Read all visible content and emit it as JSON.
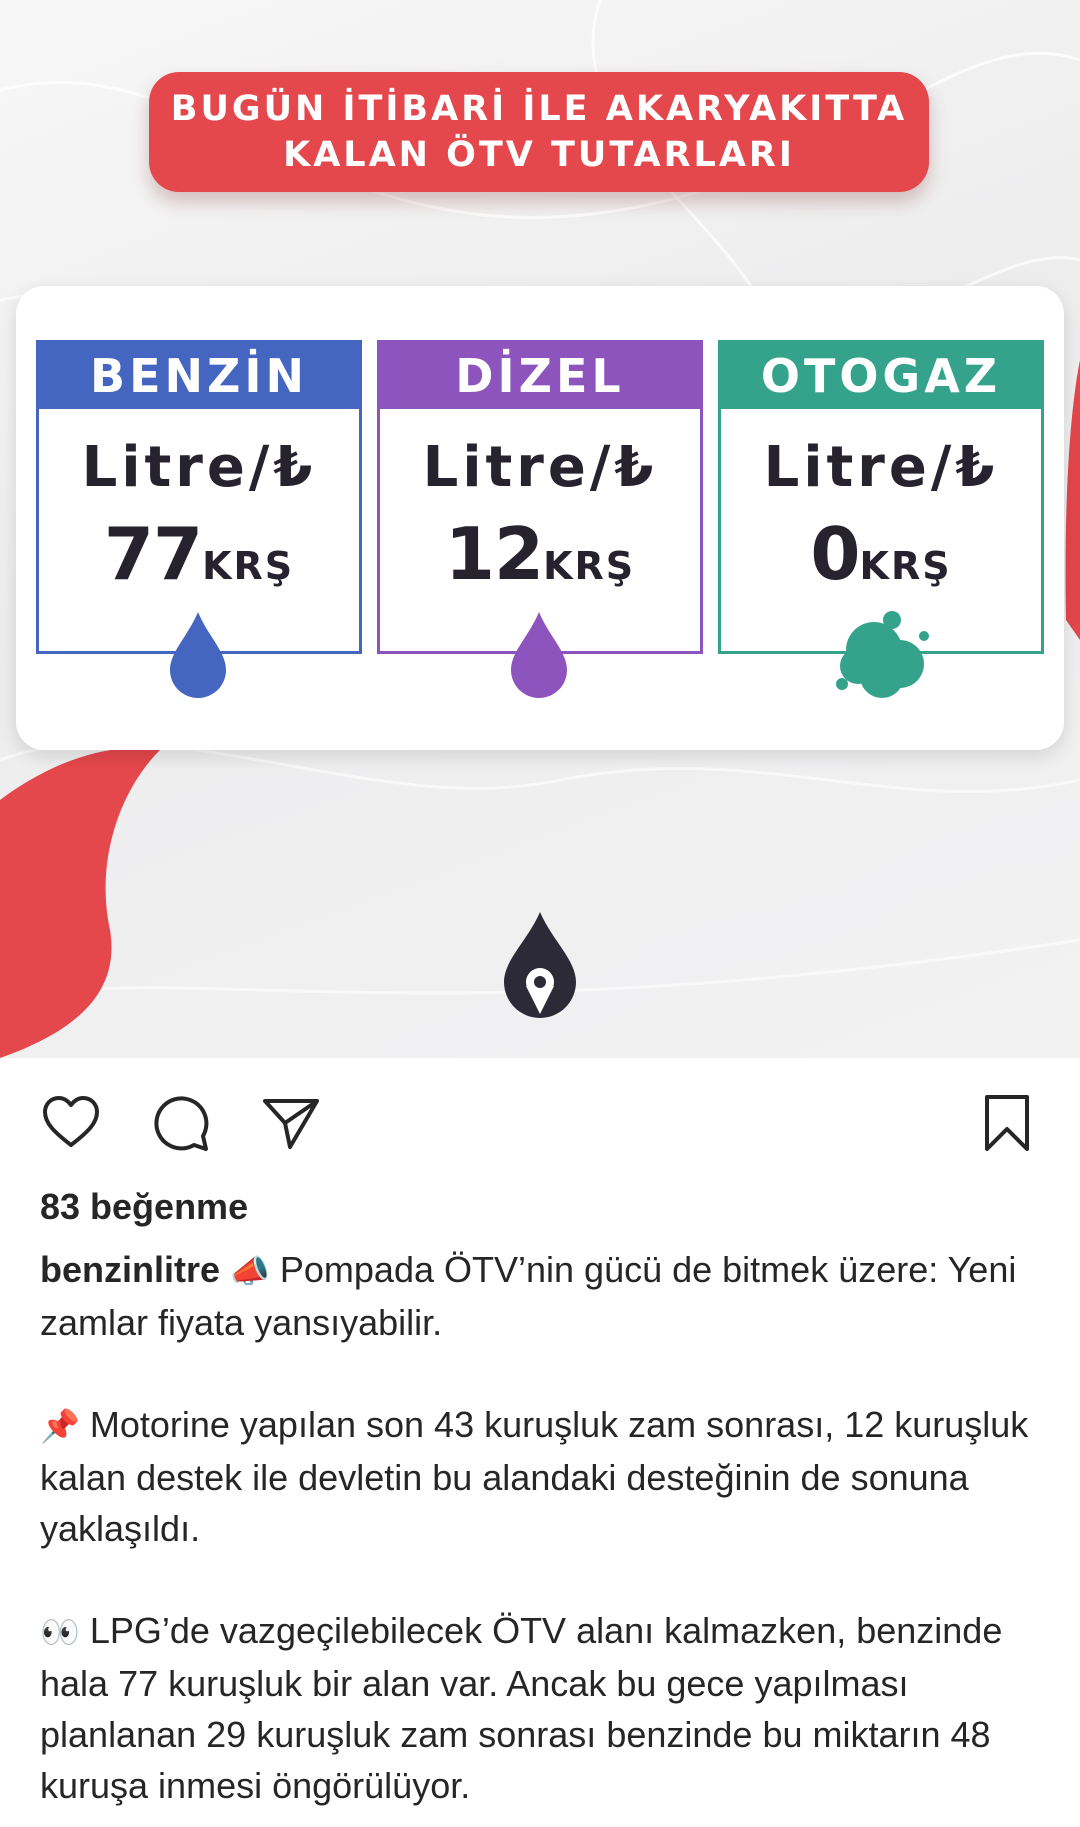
{
  "post": {
    "headline": {
      "line1": "BUGÜN İTİBARİ İLE AKARYAKITTA",
      "line2": "KALAN ÖTV TUTARLARI"
    },
    "unit_label": "Litre/₺",
    "cards": [
      {
        "name": "BENZİN",
        "value": "77",
        "suffix": "KRŞ",
        "color": "#4466c0",
        "drop_color": "#4466c0"
      },
      {
        "name": "DİZEL",
        "value": "12",
        "suffix": "KRŞ",
        "color": "#8e54bd",
        "drop_color": "#8e54bd"
      },
      {
        "name": "OTOGAZ",
        "value": "0",
        "suffix": "KRŞ",
        "color": "#35a38c",
        "drop_color": "#35a38c"
      }
    ],
    "colors": {
      "headline_bg": "#e4474c",
      "accent_red": "#e4474c",
      "logo_dark": "#2b2a36"
    }
  },
  "actions": {
    "like_icon": "heart-icon",
    "comment_icon": "comment-icon",
    "share_icon": "send-icon",
    "save_icon": "bookmark-icon"
  },
  "likes": "83 beğenme",
  "caption": {
    "username": "benzinlitre",
    "p1_emoji": "📣",
    "p1_text": " Pompada ÖTV’nin gücü de bitmek üzere: Yeni zamlar fiyata yansıyabilir.",
    "p2_emoji": "📌",
    "p2_text": " Motorine yapılan son 43 kuruşluk zam sonrası, 12 kuruşluk kalan destek ile devletin bu alandaki desteğinin de sonuna yaklaşıldı.",
    "p3_emoji": "👀",
    "p3_text": " LPG’de vazgeçilebilecek ÖTV alanı kalmazken, benzinde hala 77 kuruşluk bir alan var. Ancak bu gece yapılması planlanan 29 kuruşluk zam sonrası benzinde bu miktarın 48 kuruşa inmesi öngörülüyor."
  }
}
